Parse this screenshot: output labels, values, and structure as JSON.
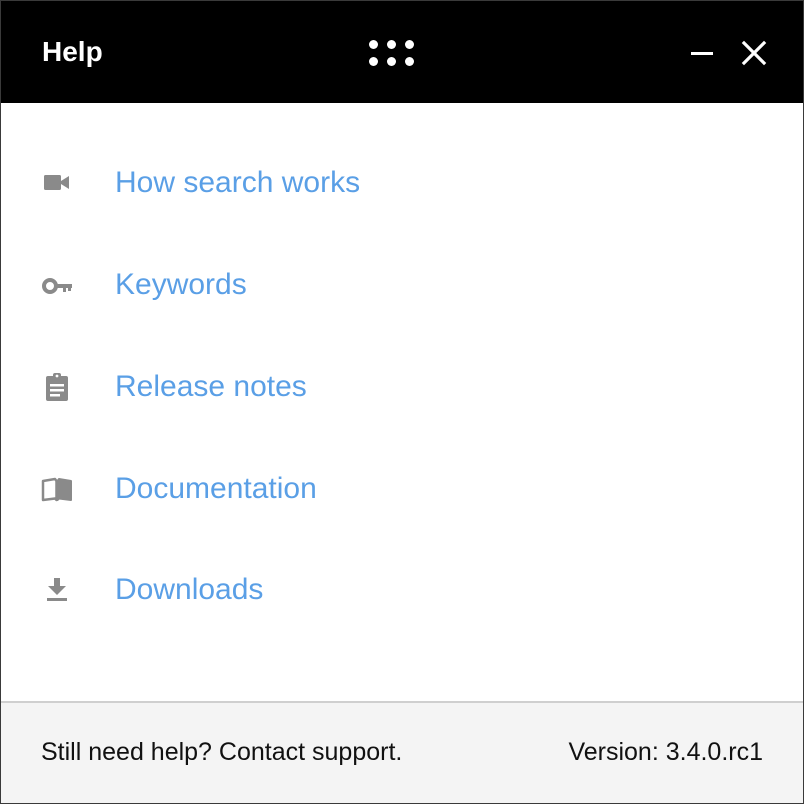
{
  "window": {
    "title": "Help"
  },
  "titlebar_buttons": {
    "drag_icon": "grip-dots-icon",
    "minimize_icon": "minimize-icon",
    "close_icon": "close-icon"
  },
  "menu": {
    "items": [
      {
        "icon": "video-camera-icon",
        "label": "How search works"
      },
      {
        "icon": "key-icon",
        "label": "Keywords"
      },
      {
        "icon": "clipboard-icon",
        "label": "Release notes"
      },
      {
        "icon": "open-book-icon",
        "label": "Documentation"
      },
      {
        "icon": "download-icon",
        "label": "Downloads"
      }
    ]
  },
  "footer": {
    "support_text": "Still need help? Contact support.",
    "version_text": "Version: 3.4.0.rc1"
  },
  "colors": {
    "titlebar_bg": "#000000",
    "link": "#5a9fe6",
    "icon": "#8a8a8a",
    "footer_bg": "#f4f4f4"
  }
}
